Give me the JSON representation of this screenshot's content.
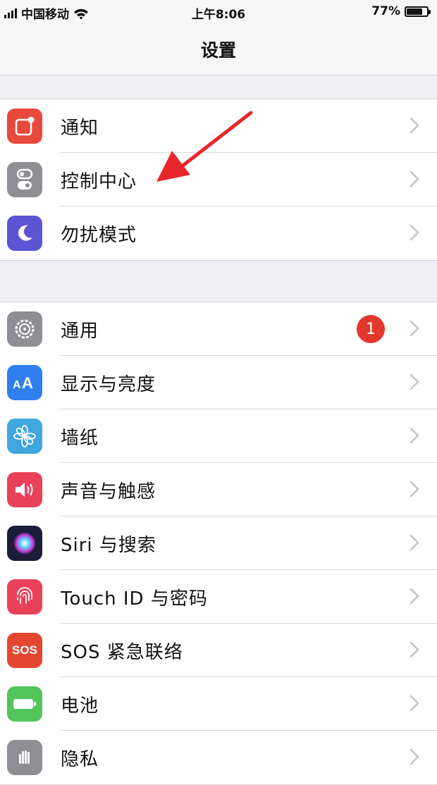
{
  "status_bar": {
    "carrier": "中国移动",
    "time": "上午8:06",
    "battery_percent": "77%",
    "battery_level": 0.77
  },
  "nav": {
    "title": "设置"
  },
  "groups": [
    {
      "items": [
        {
          "label": "通知",
          "icon": "notifications-icon",
          "color": "#e8493d"
        },
        {
          "label": "控制中心",
          "icon": "control-center-icon",
          "color": "#8e8e93"
        },
        {
          "label": "勿扰模式",
          "icon": "moon-icon",
          "color": "#5b55d3"
        }
      ]
    },
    {
      "items": [
        {
          "label": "通用",
          "icon": "gear-icon",
          "color": "#8e8e93",
          "badge": "1"
        },
        {
          "label": "显示与亮度",
          "icon": "display-aa-icon",
          "color": "#2f7ff0"
        },
        {
          "label": "墙纸",
          "icon": "wallpaper-flower-icon",
          "color": "#3fa6df"
        },
        {
          "label": "声音与触感",
          "icon": "speaker-icon",
          "color": "#e9415a"
        },
        {
          "label": "Siri 与搜索",
          "icon": "siri-icon",
          "color": "#1b1b3a"
        },
        {
          "label": "Touch ID 与密码",
          "icon": "fingerprint-icon",
          "color": "#e9415a"
        },
        {
          "label": "SOS 紧急联络",
          "icon": "sos-icon",
          "color": "#e5462f",
          "icon_text": "SOS"
        },
        {
          "label": "电池",
          "icon": "battery-icon",
          "color": "#52c55c"
        },
        {
          "label": "隐私",
          "icon": "privacy-hand-icon",
          "color": "#8e8e93"
        }
      ]
    }
  ],
  "annotation": {
    "icon": "red-arrow-icon",
    "color": "#e8262a"
  }
}
